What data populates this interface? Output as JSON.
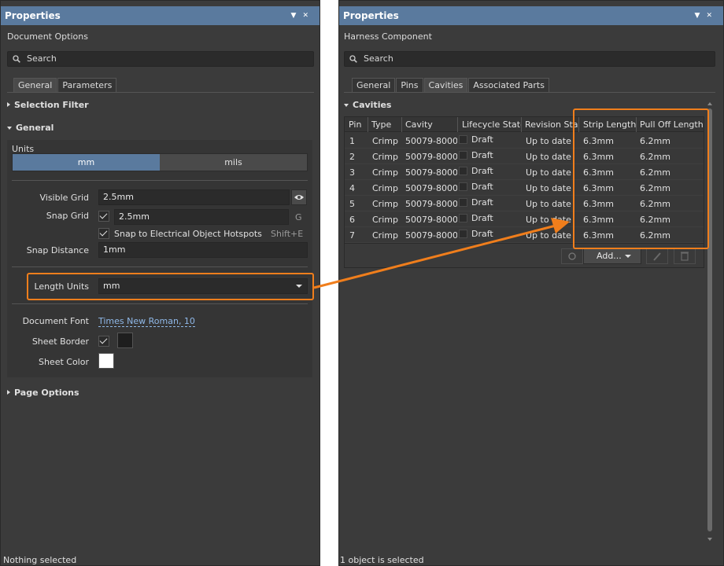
{
  "left": {
    "title": "Properties",
    "subtitle": "Document Options",
    "search_placeholder": "Search",
    "tabs": [
      "General",
      "Parameters"
    ],
    "sections": {
      "selection_filter": "Selection Filter",
      "general": "General",
      "page_options": "Page Options"
    },
    "units": {
      "label": "Units",
      "options": [
        "mm",
        "mils"
      ],
      "selected": "mm"
    },
    "visible_grid": {
      "label": "Visible Grid",
      "value": "2.5mm"
    },
    "snap_grid": {
      "label": "Snap Grid",
      "value": "2.5mm",
      "checked": true,
      "shortcut": "G"
    },
    "snap_hotspots": {
      "label": "Snap to Electrical Object Hotspots",
      "checked": true,
      "shortcut": "Shift+E"
    },
    "snap_distance": {
      "label": "Snap Distance",
      "value": "1mm"
    },
    "length_units": {
      "label": "Length Units",
      "value": "mm"
    },
    "document_font": {
      "label": "Document Font",
      "value": "Times New Roman, 10"
    },
    "sheet_border": {
      "label": "Sheet Border",
      "checked": true,
      "color": "#1e1e1e"
    },
    "sheet_color": {
      "label": "Sheet Color",
      "color": "#ffffff"
    },
    "status": "Nothing selected"
  },
  "right": {
    "title": "Properties",
    "subtitle": "Harness Component",
    "search_placeholder": "Search",
    "tabs": [
      "General",
      "Pins",
      "Cavities",
      "Associated Parts"
    ],
    "active_tab": "Cavities",
    "section": "Cavities",
    "columns": [
      "Pin",
      "Type",
      "Cavity",
      "Lifecycle State",
      "Revision Stat",
      "Strip Length",
      "Pull Off Length"
    ],
    "rows": [
      {
        "pin": "1",
        "type": "Crimp",
        "cavity": "50079-8000",
        "lifecycle": "Draft",
        "revision": "Up to date",
        "strip": "6.3mm",
        "pull": "6.2mm"
      },
      {
        "pin": "2",
        "type": "Crimp",
        "cavity": "50079-8000",
        "lifecycle": "Draft",
        "revision": "Up to date",
        "strip": "6.3mm",
        "pull": "6.2mm"
      },
      {
        "pin": "3",
        "type": "Crimp",
        "cavity": "50079-8000",
        "lifecycle": "Draft",
        "revision": "Up to date",
        "strip": "6.3mm",
        "pull": "6.2mm"
      },
      {
        "pin": "4",
        "type": "Crimp",
        "cavity": "50079-8000",
        "lifecycle": "Draft",
        "revision": "Up to date",
        "strip": "6.3mm",
        "pull": "6.2mm"
      },
      {
        "pin": "5",
        "type": "Crimp",
        "cavity": "50079-8000",
        "lifecycle": "Draft",
        "revision": "Up to date",
        "strip": "6.3mm",
        "pull": "6.2mm"
      },
      {
        "pin": "6",
        "type": "Crimp",
        "cavity": "50079-8000",
        "lifecycle": "Draft",
        "revision": "Up to date",
        "strip": "6.3mm",
        "pull": "6.2mm"
      },
      {
        "pin": "7",
        "type": "Crimp",
        "cavity": "50079-8000",
        "lifecycle": "Draft",
        "revision": "Up to date",
        "strip": "6.3mm",
        "pull": "6.2mm"
      }
    ],
    "add_button": "Add...",
    "status": "1 object is selected"
  },
  "colors": {
    "accent": "#5a7a9e",
    "highlight": "#f07e1c",
    "panel_bg": "#3b3b3b",
    "link": "#8fb8e8"
  }
}
